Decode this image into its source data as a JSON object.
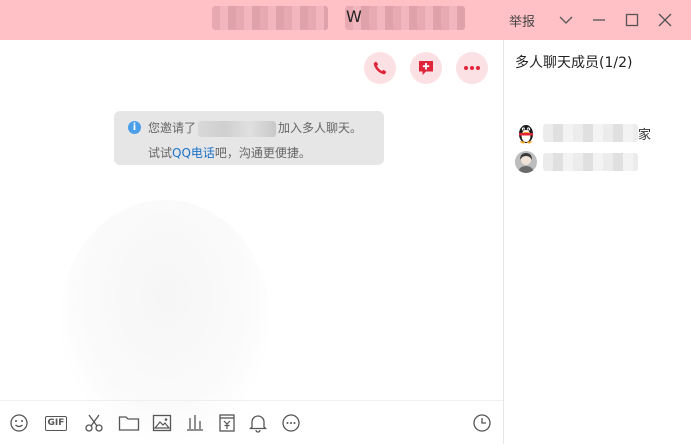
{
  "titlebar": {
    "title_visible": "W",
    "report_label": "举报",
    "controls": [
      "chevron-down-icon",
      "minimize-icon",
      "maximize-icon",
      "close-icon"
    ]
  },
  "chat": {
    "actions": [
      {
        "name": "voice-call-button",
        "icon": "phone-icon"
      },
      {
        "name": "add-member-button",
        "icon": "add-chat-icon"
      },
      {
        "name": "more-button",
        "icon": "ellipsis-icon"
      }
    ],
    "notice": {
      "line1_prefix": "您邀请了",
      "line1_suffix": "加入多人聊天。",
      "line2_prefix": "试试",
      "line2_link": "QQ电话",
      "line2_suffix": "吧，沟通更便捷。"
    }
  },
  "toolbar": {
    "gif_label": "GIF",
    "tools": [
      "emoji-icon",
      "gif-icon",
      "scissors-icon",
      "folder-icon",
      "image-icon",
      "chart-icon",
      "yuan-icon",
      "bell-icon",
      "more-circle-icon",
      "history-clock-icon"
    ]
  },
  "sidebar": {
    "title": "多人聊天成员(1/2)",
    "members": [
      {
        "avatar": "qq-penguin-avatar",
        "suffix": "家"
      },
      {
        "avatar": "photo-avatar",
        "suffix": ""
      }
    ]
  },
  "colors": {
    "titlebar_bg": "#ffc0c6",
    "accent_red": "#e0243a",
    "action_bg": "#fbe1e4",
    "link_blue": "#1a73c8",
    "info_blue": "#4a9fe8"
  }
}
